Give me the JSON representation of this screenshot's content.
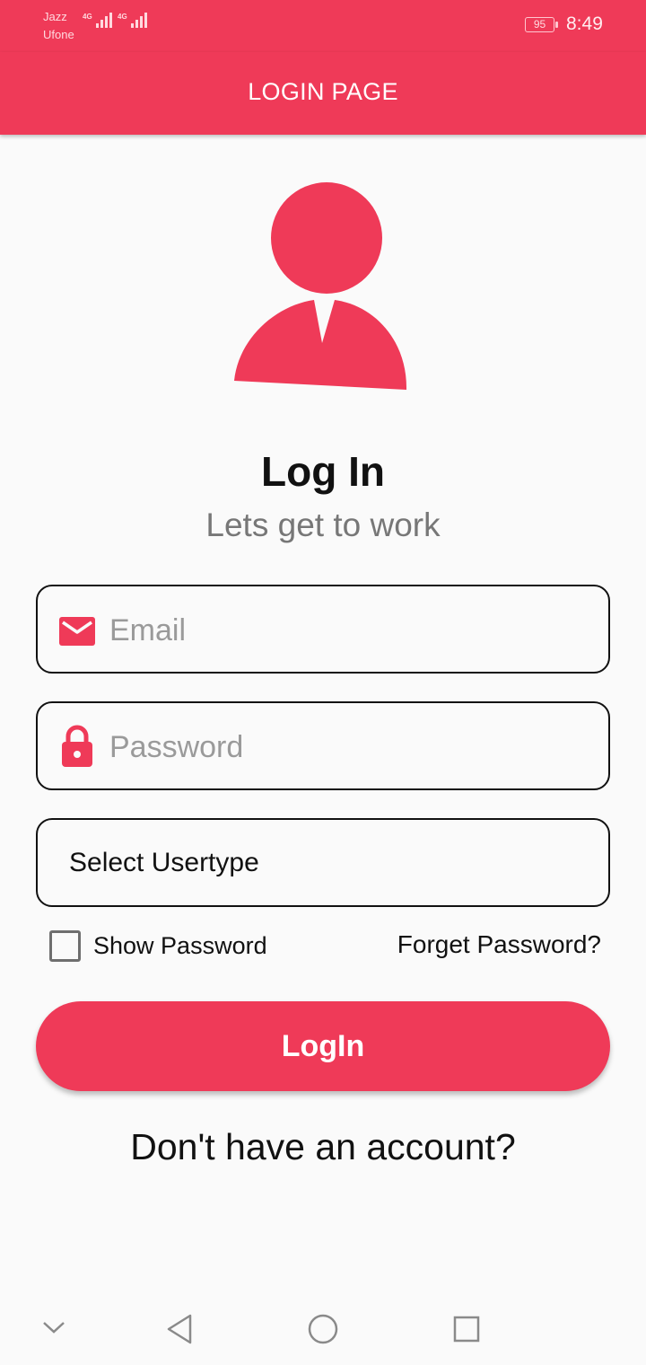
{
  "status_bar": {
    "carrier_1": "Jazz",
    "carrier_2": "Ufone",
    "network_1": "4G",
    "network_2": "4G",
    "battery": "95",
    "time": "8:49"
  },
  "app_bar": {
    "title": "LOGIN PAGE"
  },
  "avatar_icon": "person-icon",
  "heading": {
    "title": "Log In",
    "subtitle": "Lets get to work"
  },
  "form": {
    "email": {
      "placeholder": "Email",
      "value": "",
      "icon": "mail-icon"
    },
    "password": {
      "placeholder": "Password",
      "value": "",
      "icon": "lock-icon"
    },
    "usertype": {
      "selected": "Select Usertype"
    },
    "show_password": {
      "label": "Show Password",
      "checked": false
    },
    "forget_password": "Forget Password?",
    "login_button": "LogIn"
  },
  "signup_prompt": "Don't have an account?",
  "nav": {
    "icons": [
      "chevron-down-icon",
      "back-icon",
      "home-icon",
      "recents-icon"
    ]
  },
  "colors": {
    "accent": "#ef3a58",
    "background": "#fafafa",
    "text": "#111111",
    "muted": "#777777"
  }
}
